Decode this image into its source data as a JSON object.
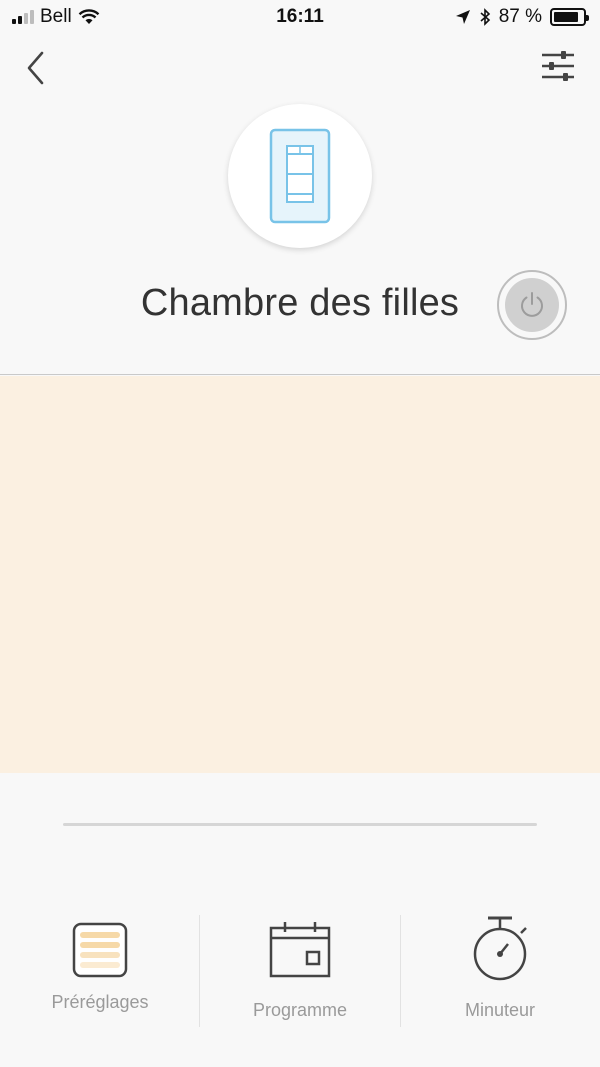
{
  "status_bar": {
    "carrier": "Bell",
    "time": "16:11",
    "battery_percent": "87 %",
    "battery_level": 0.87
  },
  "device": {
    "name": "Chambre des filles",
    "icon": "dimmer-switch-icon",
    "power_state": "off"
  },
  "colors": {
    "accent_light": "#fbf0e1",
    "device_icon": "#78c3e8",
    "preset_stripes": "#f6d9a8"
  },
  "tabs": [
    {
      "label": "Préréglages",
      "icon": "presets-icon",
      "active": true
    },
    {
      "label": "Programme",
      "icon": "calendar-icon",
      "active": false
    },
    {
      "label": "Minuteur",
      "icon": "stopwatch-icon",
      "active": false
    }
  ]
}
